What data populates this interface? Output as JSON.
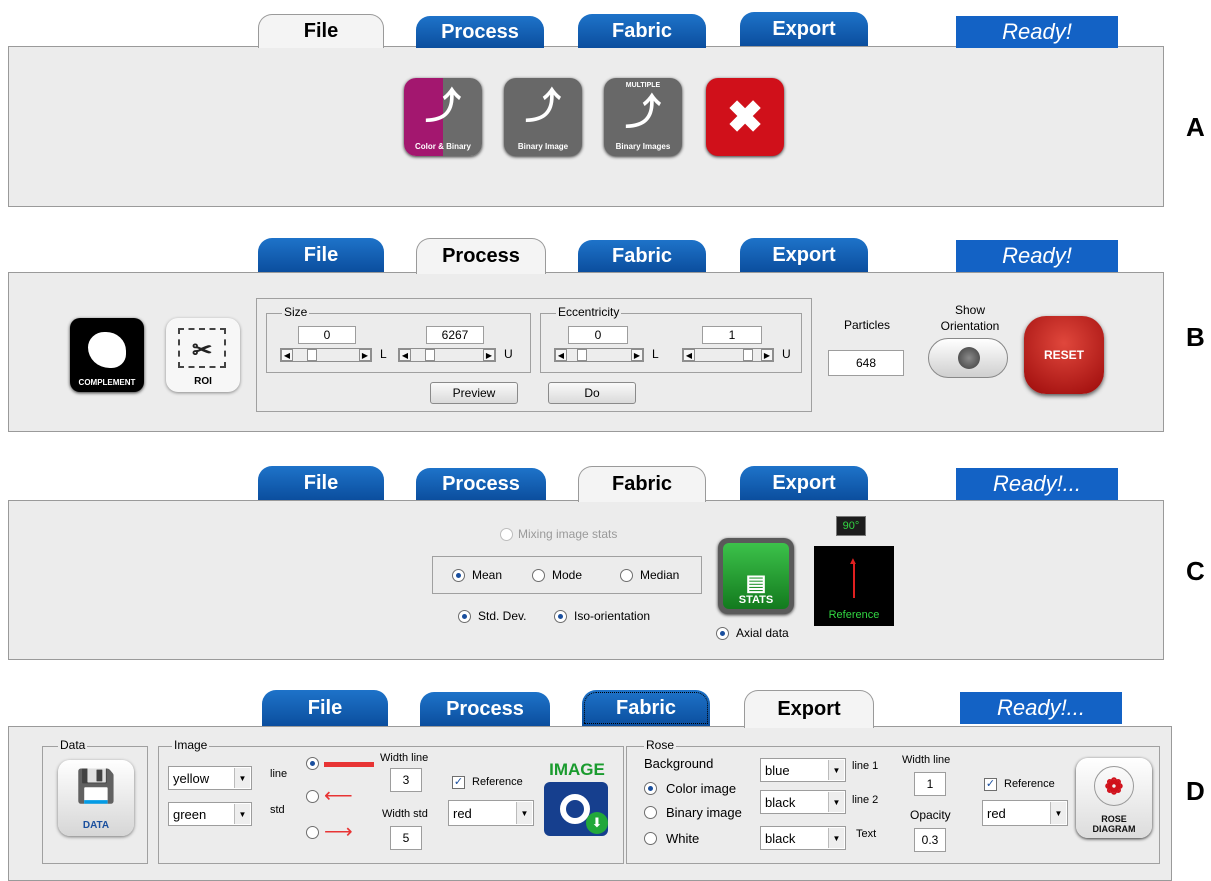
{
  "tabs": [
    "File",
    "Process",
    "Fabric",
    "Export"
  ],
  "panelA": {
    "status": "Ready!",
    "letter": "A",
    "buttons": [
      "Color & Binary",
      "Binary Image",
      "Binary Images",
      "MULTIPLE"
    ]
  },
  "panelB": {
    "status": "Ready!",
    "letter": "B",
    "complement_label": "COMPLEMENT",
    "roi_label": "ROI",
    "size_label": "Size",
    "size_lower": "0",
    "size_upper": "6267",
    "ecc_label": "Eccentricity",
    "ecc_lower": "0",
    "ecc_upper": "1",
    "l_label": "L",
    "u_label": "U",
    "preview_button": "Preview",
    "do_button": "Do",
    "particles_label": "Particles",
    "particles_value": "648",
    "show_orientation_label": "Show Orientation",
    "reset_button": "RESET"
  },
  "panelC": {
    "status": "Ready!...",
    "letter": "C",
    "mixing": "Mixing image stats",
    "mean": "Mean",
    "mode": "Mode",
    "median": "Median",
    "std": "Std. Dev.",
    "iso": "Iso-orientation",
    "stats": "STATS",
    "axial": "Axial data",
    "angle": "90°",
    "reference": "Reference"
  },
  "panelD": {
    "status": "Ready!...",
    "letter": "D",
    "data_group": "Data",
    "data_button": "DATA",
    "image_group": "Image",
    "line_color": "yellow",
    "line_label": "line",
    "std_color": "green",
    "std_label": "std",
    "width_line_label": "Width line",
    "width_line_value": "3",
    "width_std_label": "Width std",
    "width_std_value": "5",
    "reference_label": "Reference",
    "reference_color": "red",
    "image_button": "IMAGE",
    "rose_group": "Rose",
    "background_label": "Background",
    "color_image": "Color image",
    "binary_image": "Binary image",
    "white": "White",
    "bg_line1": "blue",
    "bg_line2": "black",
    "bg_text": "black",
    "line1_label": "line 1",
    "line2_label": "line 2",
    "text_label": "Text",
    "rose_width_line_label": "Width line",
    "rose_width_line_value": "1",
    "opacity_label": "Opacity",
    "opacity_value": "0.3",
    "rose_reference_label": "Reference",
    "rose_reference_color": "red",
    "rose_button_line1": "ROSE",
    "rose_button_line2": "DIAGRAM"
  },
  "colors": {
    "tab_blue": "#0b4e9e",
    "status_blue": "#1362c5",
    "panel_bg": "#ececec",
    "magenta": "#a3176f",
    "close_red": "#d0101a",
    "stats_green": "#1f9a2e"
  }
}
